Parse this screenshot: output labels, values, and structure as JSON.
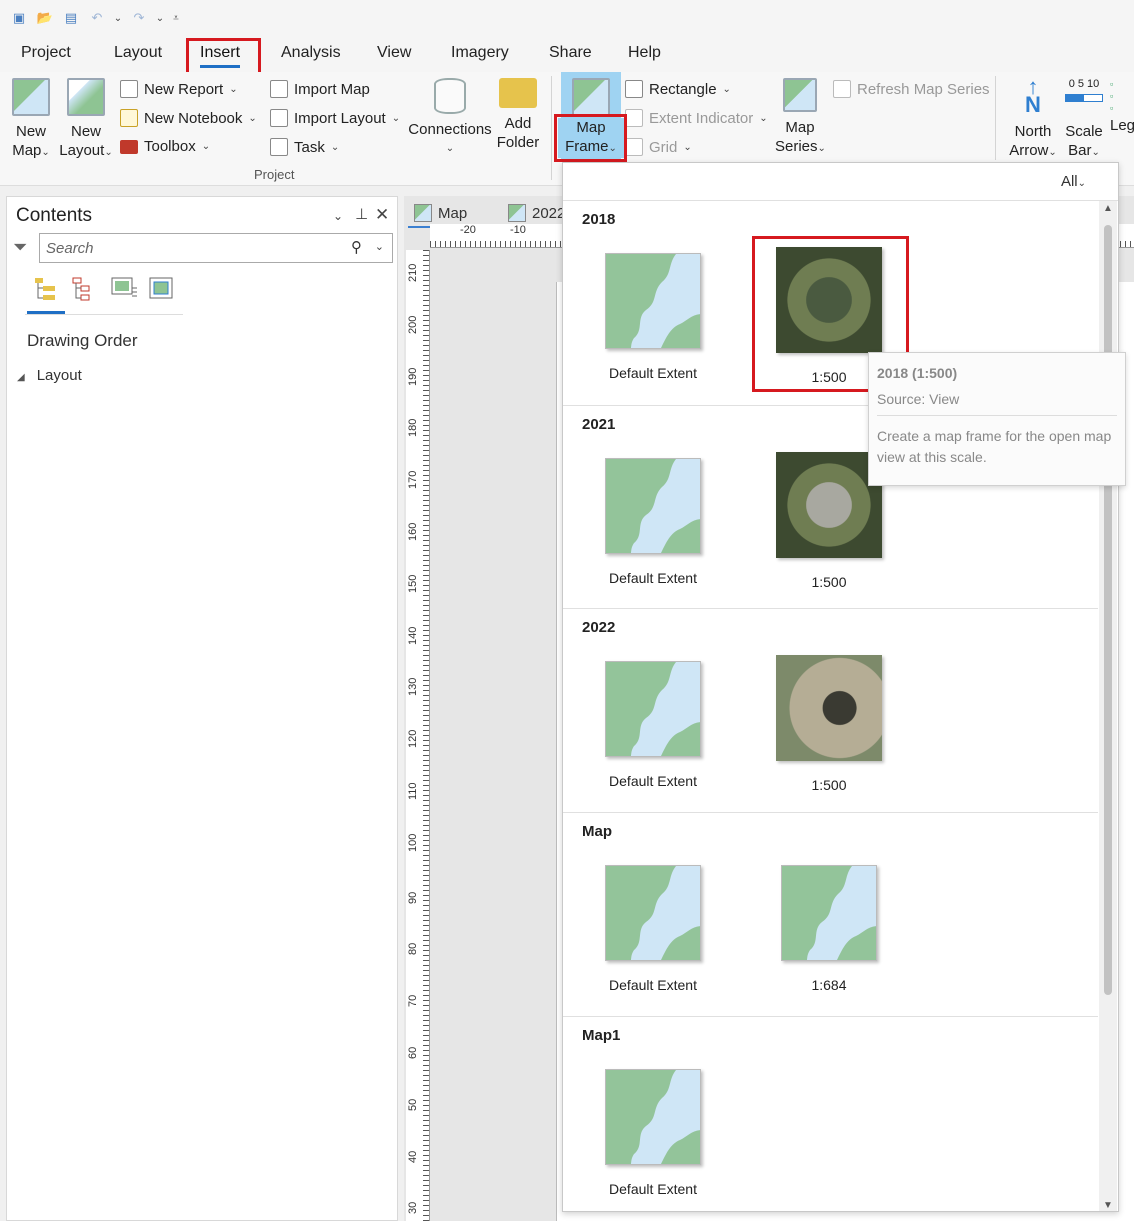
{
  "tabs": [
    "Project",
    "Layout",
    "Insert",
    "Analysis",
    "View",
    "Imagery",
    "Share",
    "Help"
  ],
  "ribbon": {
    "new_map": [
      "New",
      "Map"
    ],
    "new_layout": [
      "New",
      "Layout"
    ],
    "new_report": "New Report",
    "new_notebook": "New Notebook",
    "toolbox": "Toolbox",
    "import_map": "Import Map",
    "import_layout": "Import Layout",
    "task": "Task",
    "connections": "Connections",
    "add_folder": [
      "Add",
      "Folder"
    ],
    "project_group": "Project",
    "map_frame": [
      "Map",
      "Frame"
    ],
    "rectangle": "Rectangle",
    "extent_indicator": "Extent Indicator",
    "grid": "Grid",
    "map_series": [
      "Map",
      "Series"
    ],
    "refresh_map_series": "Refresh Map Series",
    "north_arrow": [
      "North",
      "Arrow"
    ],
    "scale_bar": [
      "Scale",
      "Bar"
    ],
    "scale_bar_ticks": "0  5  10",
    "legend_partial": "Leg"
  },
  "contents": {
    "title": "Contents",
    "search_placeholder": "Search",
    "drawing_order": "Drawing Order",
    "layout_node": "Layout"
  },
  "view": {
    "tab_map": "Map",
    "tab_2022": "2022",
    "hruler": [
      "-20",
      "-10"
    ],
    "vruler": [
      "210",
      "200",
      "190",
      "180",
      "170",
      "160",
      "150",
      "140",
      "130",
      "120",
      "110",
      "100",
      "90",
      "80",
      "70",
      "60",
      "50",
      "40",
      "30"
    ]
  },
  "gallery": {
    "filter": "All",
    "sections": [
      {
        "title": "2018",
        "items": [
          {
            "label": "Default Extent",
            "kind": "default"
          },
          {
            "label": "1:500",
            "kind": "photo"
          }
        ]
      },
      {
        "title": "2021",
        "items": [
          {
            "label": "Default Extent",
            "kind": "default"
          },
          {
            "label": "1:500",
            "kind": "photo"
          }
        ]
      },
      {
        "title": "2022",
        "items": [
          {
            "label": "Default Extent",
            "kind": "default"
          },
          {
            "label": "1:500",
            "kind": "photo"
          }
        ]
      },
      {
        "title": "Map",
        "items": [
          {
            "label": "Default Extent",
            "kind": "default"
          },
          {
            "label": "1:684",
            "kind": "default"
          }
        ]
      },
      {
        "title": "Map1",
        "items": [
          {
            "label": "Default Extent",
            "kind": "default"
          }
        ]
      }
    ]
  },
  "tooltip": {
    "title": "2018 (1:500)",
    "source": "Source: View",
    "description": "Create a map frame for the open map view at this scale."
  },
  "colors": {
    "accent": "#1f6fc5",
    "highlight": "#d6191f",
    "selected": "#9fd3f2"
  }
}
